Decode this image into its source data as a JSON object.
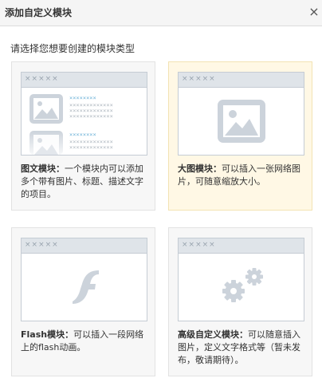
{
  "dialog": {
    "title": "添加自定义模块",
    "close_glyph": "×",
    "prompt": "请选择您想要创建的模块类型"
  },
  "placeholder": {
    "dots": "×××××",
    "link_text": "××××××××",
    "body_text": "×××××××××××××"
  },
  "cards": [
    {
      "name": "图文模块：",
      "desc": "一个模块内可以添加多个带有图片、标题、描述文字的项目。"
    },
    {
      "name": "大图模块：",
      "desc": "可以插入一张网络图片，可随意缩放大小。"
    },
    {
      "name": "Flash模块：",
      "desc": "可以插入一段网络上的flash动画。"
    },
    {
      "name": "高级自定义模块：",
      "desc": "可以随意插入图片，定义文字格式等（暂未发布，敬请期待）。"
    }
  ],
  "colors": {
    "selected_bg": "#fff8e5",
    "card_bg": "#f7f7f7",
    "icon_gray": "#ccd3db",
    "link_blue": "#6fb3d8"
  }
}
